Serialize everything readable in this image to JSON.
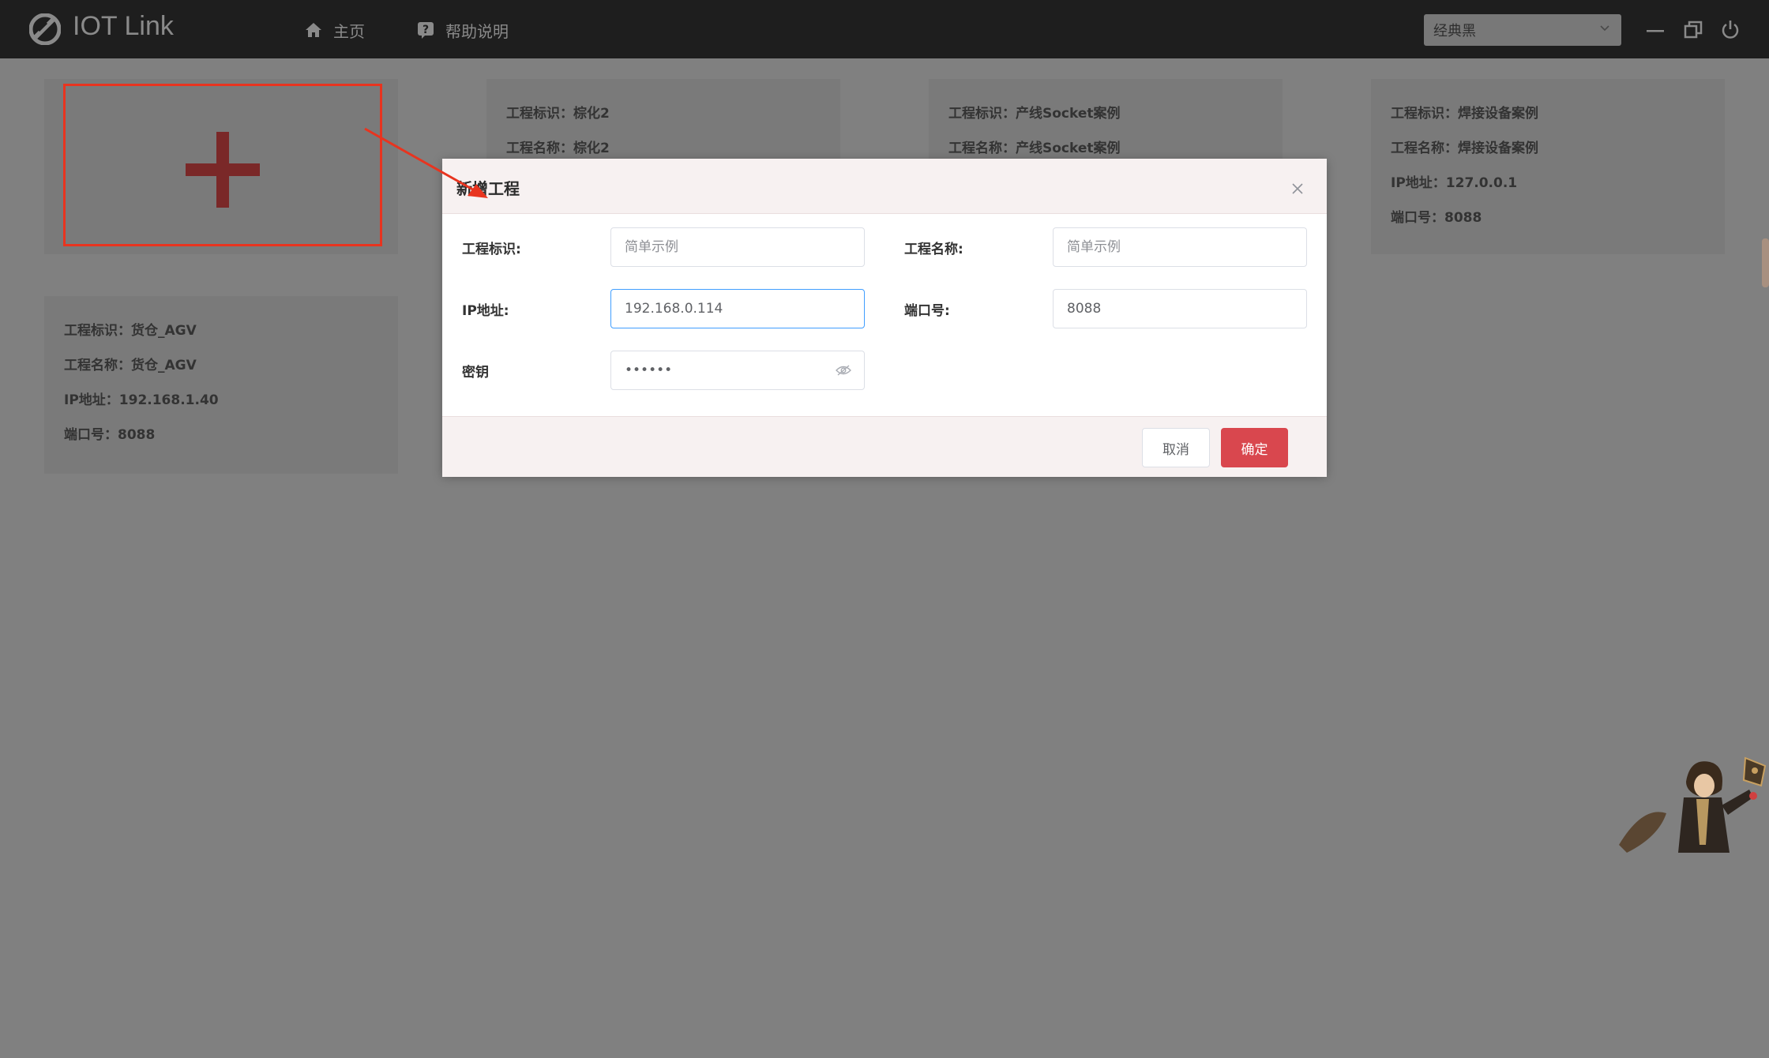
{
  "app": {
    "title": "IOT Link"
  },
  "nav": [
    {
      "label": "主页",
      "icon": "home-icon"
    },
    {
      "label": "帮助说明",
      "icon": "help-icon"
    }
  ],
  "theme_select": {
    "value": "经典黑"
  },
  "window_controls": [
    "minimize-icon",
    "restore-icon",
    "power-icon"
  ],
  "cards": [
    {
      "id_label": "工程标识：棕化2",
      "name_label": "工程名称：棕化2"
    },
    {
      "id_label": "工程标识：产线Socket案例",
      "name_label": "工程名称：产线Socket案例"
    },
    {
      "id_label": "工程标识：焊接设备案例",
      "name_label": "工程名称：焊接设备案例",
      "ip_label": "IP地址：127.0.0.1",
      "port_label": "端口号：8088"
    },
    {
      "id_label": "工程标识：货仓_AGV",
      "name_label": "工程名称：货仓_AGV",
      "ip_label": "IP地址：192.168.1.40",
      "port_label": "端口号：8088"
    }
  ],
  "dialog": {
    "title": "新增工程",
    "fields": {
      "project_id": {
        "label": "工程标识:",
        "value": "",
        "placeholder": "简单示例"
      },
      "project_name": {
        "label": "工程名称:",
        "value": "",
        "placeholder": "简单示例"
      },
      "ip": {
        "label": "IP地址:",
        "value": "192.168.0.114",
        "placeholder": ""
      },
      "port": {
        "label": "端口号:",
        "value": "8088",
        "placeholder": ""
      },
      "secret": {
        "label": "密钥",
        "value": "••••••",
        "placeholder": ""
      }
    },
    "cancel_label": "取消",
    "confirm_label": "确定"
  },
  "colors": {
    "topbar": "#1e1e1e",
    "overlay": "#808080",
    "primary_button": "#d9474e",
    "highlight_border": "#e8341f",
    "input_focus": "#409eff"
  }
}
